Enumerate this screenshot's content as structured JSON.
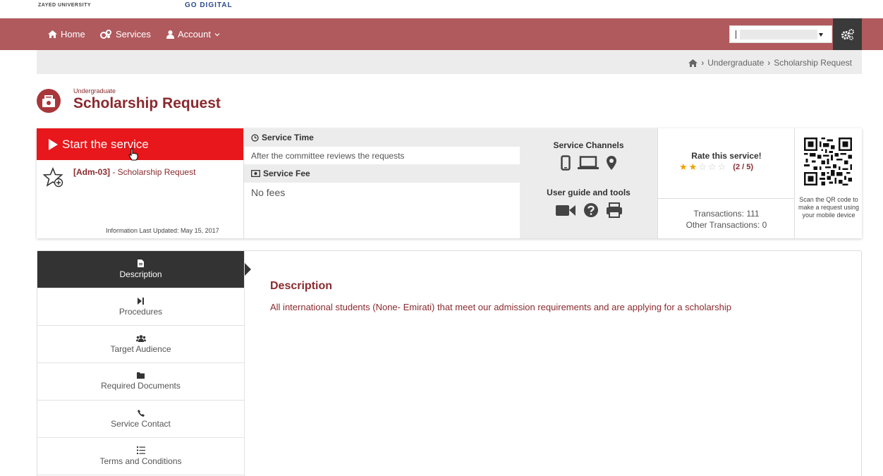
{
  "header_strip": {
    "logo_left": "ZAYED UNIVERSITY",
    "logo_right": "GO DIGITAL"
  },
  "nav": {
    "items": [
      {
        "label": "Home",
        "icon": "home-icon"
      },
      {
        "label": "Services",
        "icon": "services-icon"
      },
      {
        "label": "Account",
        "icon": "user-icon",
        "dropdown": true
      }
    ],
    "select_value": "",
    "settings_icon": "gears-icon"
  },
  "breadcrumb": {
    "home_icon": "home-icon",
    "items": [
      "Undergraduate",
      "Scholarship Request"
    ]
  },
  "page": {
    "category": "Undergraduate",
    "title": "Scholarship Request"
  },
  "service_card": {
    "start_label": "Start the service",
    "code": "[Adm-03]",
    "code_suffix": " - Scholarship Request",
    "updated": "Information Last Updated: May 15, 2017",
    "service_time_label": "Service Time",
    "service_time_value": "After the committee reviews the requests",
    "service_fee_label": "Service Fee",
    "service_fee_value": "No fees",
    "channels_title": "Service Channels",
    "channels_icons": [
      "mobile-icon",
      "laptop-icon",
      "location-pin-icon"
    ],
    "guide_title": "User guide and tools",
    "guide_icons": [
      "video-icon",
      "help-icon",
      "print-icon"
    ],
    "rate_title": "Rate this service!",
    "rating": 2,
    "rating_max": 5,
    "rating_text": "(2 / 5)",
    "transactions": "Transactions: 111",
    "other_transactions": "Other Transactions: 0",
    "qr_caption": "Scan the QR code to make a request using your mobile device"
  },
  "tabs": [
    {
      "label": "Description",
      "icon": "file-icon",
      "active": true
    },
    {
      "label": "Procedures",
      "icon": "step-forward-icon",
      "active": false
    },
    {
      "label": "Target Audience",
      "icon": "users-icon",
      "active": false
    },
    {
      "label": "Required Documents",
      "icon": "folder-icon",
      "active": false
    },
    {
      "label": "Service Contact",
      "icon": "phone-icon",
      "active": false
    },
    {
      "label": "Terms and Conditions",
      "icon": "list-icon",
      "active": false
    }
  ],
  "description": {
    "title": "Description",
    "text": "All international students (None- Emirati) that meet our admission requirements and are applying for a scholarship"
  },
  "colors": {
    "navbar": "#b05a5e",
    "brand_dark": "#8a2a2e",
    "start_button": "#e8171b",
    "star": "#f0a000"
  }
}
